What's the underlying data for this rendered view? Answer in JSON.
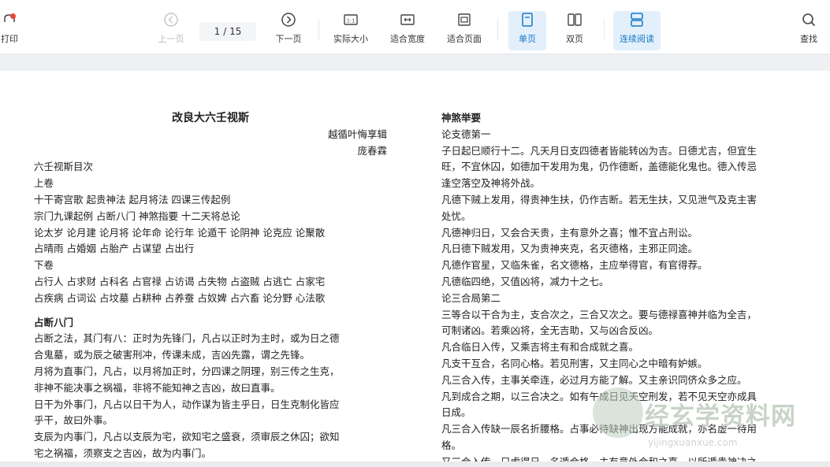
{
  "toolbar": {
    "print_label": "打印",
    "prev_label": "上一页",
    "page_current": "1",
    "page_total": "/ 15",
    "next_label": "下一页",
    "actual_size_label": "实际大小",
    "fit_width_label": "适合宽度",
    "fit_page_label": "适合页面",
    "single_page_label": "单页",
    "double_page_label": "双页",
    "continuous_label": "连续阅读",
    "search_label": "查找",
    "icons": {
      "print": "printer-icon",
      "prev": "arrow-left-circle-icon",
      "next": "arrow-right-circle-icon",
      "actual": "actual-size-icon",
      "fit_width": "fit-width-icon",
      "fit_page": "fit-page-icon",
      "single": "single-page-icon",
      "double": "double-page-icon",
      "continuous": "continuous-scroll-icon",
      "search": "search-icon"
    },
    "accent_color": "#1677c7",
    "notification_color": "#e8453c"
  },
  "document": {
    "title": "改良大六壬视斯",
    "author1": "越循叶悔享辑",
    "author2": "庞春霖",
    "left_lines": [
      "六壬视斯目次",
      "上卷",
      "十干寄宫歌 起贵神法 起月将法 四课三传起例",
      "宗门九课起例 占断八门 神煞指要 十二天将总论",
      "论太岁 论月建 论月将 论年命 论行年 论遁干 论阴神 论克应 论聚散",
      "占晴雨 占婚姻 占胎产 占谋望 占出行",
      "下卷",
      "占行人 占求财 占科名 占官禄 占访谒 占失物 占盗贼 占逃亡 占家宅",
      "占疾病 占词讼 占坟墓 占耕种 占养蚕 占奴婢 占六畜 论分野 心法歌"
    ],
    "section2_title": "占断八门",
    "section2_lines": [
      "占断之法，其门有八：正时为先锋门，凡占以正时为主时，或为日之德",
      "合鬼墓，或为辰之破害刑冲，传课未成，吉凶先露，谓之先锋。",
      "月将为直事门，凡占，以月将加正时，分四课之阴理，别三传之生克，",
      "非神不能决事之祸福，非将不能知神之吉凶，故曰直事。",
      "日干为外事门，凡占以日干为人，动作谋为皆主乎日，日生克制化皆应",
      "乎干，故曰外事。",
      "支辰为内事门，凡占以支辰为宅，欲知宅之盛衰，须审辰之休囚；欲知",
      "宅之祸福，须察支之吉凶，故为内事门。"
    ],
    "right_title": "神煞举要",
    "right_sub1": "论支德第一",
    "right_lines1": [
      "子日起巳顺行十二。凡天月日支四德者皆能转凶为吉。日德尤吉，但宜生",
      "旺，不宜休囚，如德加干发用为鬼，仍作德断，盖德能化鬼也。德入传忌",
      "逢空落空及神将外战。",
      "凡德下贼上发用，得贵神生扶，仍作吉断。若无生扶，又见泄气及克主害",
      "处忧。",
      "凡德神归日，又会合天贵，主有意外之喜；惟不宜占刑讼。",
      "凡日德下贼发用，又为贵神夹克，名灭德格，主邪正同途。",
      "凡德作官星，又临朱雀，名文德格，主应举得官，有官得荐。",
      "凡德临四绝，又值凶将，减力十之七。"
    ],
    "right_sub2": "论三合局第二",
    "right_lines2": [
      "三等合以干合为主，支合次之，三合又次之。要与德禄喜神并临为全吉，",
      "可制诸凶。若乘凶将，全无吉助，又与凶合反凶。",
      "凡合临日入传，又乘吉将主有和合成就之喜。",
      "凡支干互合，名同心格。若见刑害，又主同心之中暗有妒嫉。",
      "凡三合入传，主事关牵连，必过月方能了解。又主亲识同侪众多之应。",
      "凡到成合之期，以三合决之。如有午成日见天空刑发，若不见天空亦成具",
      "日成。",
      "凡三合入传缺一辰名折腰格。占事必待缺神出现方能成就，亦名虚一待用",
      "格。",
      "又三合入传，只虚得日，名遁合格，主有意外合和之喜，以所遁贵神决之"
    ]
  },
  "watermark": {
    "text": "经玄学资料网",
    "url": "yijingxuanxue.com"
  }
}
